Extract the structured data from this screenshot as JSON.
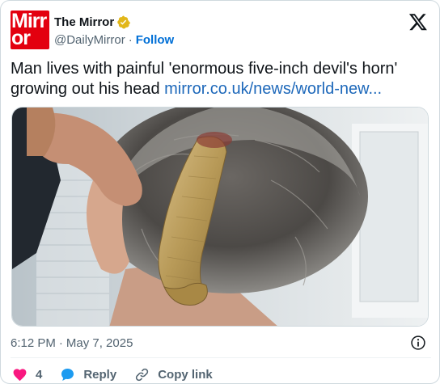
{
  "header": {
    "avatar_line1": "Mirr",
    "avatar_line2": "or",
    "display_name": "The Mirror",
    "handle": "@DailyMirror",
    "separator": "·",
    "follow_label": "Follow"
  },
  "tweet": {
    "text": "Man lives with painful 'enormous five-inch devil's horn' growing out his head",
    "link": "mirror.co.uk/news/world-new..."
  },
  "meta": {
    "time": "6:12 PM",
    "separator": "·",
    "date": "May 7, 2025"
  },
  "actions": {
    "like_count": "4",
    "reply_label": "Reply",
    "copy_link_label": "Copy link"
  },
  "colors": {
    "brand_red": "#e3000f",
    "follow_blue": "#006fd6",
    "link_blue": "#1d68ba",
    "like_pink": "#f91880",
    "reply_blue": "#1d9bf0",
    "verified_gold": "#e2b719"
  },
  "icons": {
    "verified": "verified-gold-badge-icon",
    "platform": "x-logo-icon",
    "info": "info-icon",
    "like": "heart-icon",
    "reply": "speech-bubble-icon",
    "copy": "link-icon"
  }
}
